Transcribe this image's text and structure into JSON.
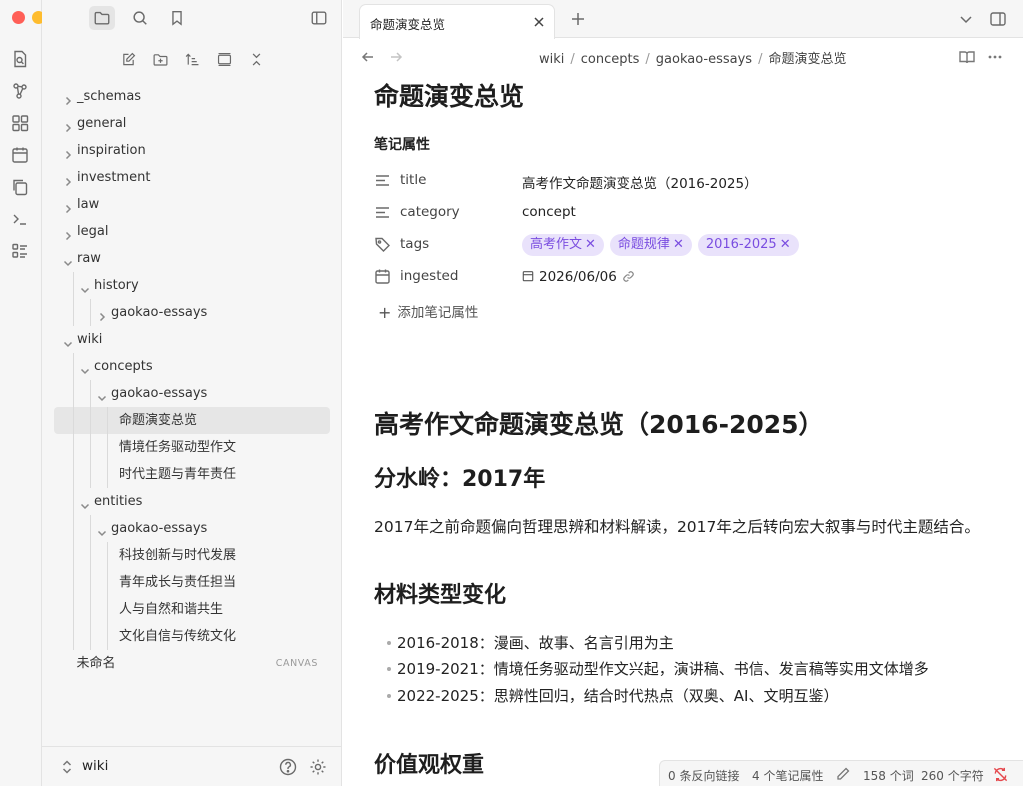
{
  "window": {
    "traffic_colors": [
      "#ff5f57",
      "#febc2e",
      "#28c840"
    ]
  },
  "ribbon": {
    "icons": [
      "file-search-icon",
      "graph-icon",
      "blocks-icon",
      "calendar-icon",
      "copy-icon",
      "terminal-icon",
      "list-icon"
    ]
  },
  "sidebar": {
    "top_icons": [
      "folder-icon",
      "search-icon",
      "bookmark-icon"
    ],
    "nav_icons": [
      "new-note-icon",
      "new-folder-icon",
      "sort-icon",
      "collapse-view-icon",
      "collapse-all-icon"
    ],
    "tree": [
      {
        "label": "_schemas",
        "depth": 0,
        "chevron": "right"
      },
      {
        "label": "general",
        "depth": 0,
        "chevron": "right"
      },
      {
        "label": "inspiration",
        "depth": 0,
        "chevron": "right"
      },
      {
        "label": "investment",
        "depth": 0,
        "chevron": "right"
      },
      {
        "label": "law",
        "depth": 0,
        "chevron": "right"
      },
      {
        "label": "legal",
        "depth": 0,
        "chevron": "right"
      },
      {
        "label": "raw",
        "depth": 0,
        "chevron": "down"
      },
      {
        "label": "history",
        "depth": 1,
        "chevron": "down"
      },
      {
        "label": "gaokao-essays",
        "depth": 2,
        "chevron": "right"
      },
      {
        "label": "wiki",
        "depth": 0,
        "chevron": "down"
      },
      {
        "label": "concepts",
        "depth": 1,
        "chevron": "down"
      },
      {
        "label": "gaokao-essays",
        "depth": 2,
        "chevron": "down"
      },
      {
        "label": "命题演变总览",
        "depth": 3,
        "chevron": "none",
        "active": true
      },
      {
        "label": "情境任务驱动型作文",
        "depth": 3,
        "chevron": "none"
      },
      {
        "label": "时代主题与青年责任",
        "depth": 3,
        "chevron": "none"
      },
      {
        "label": "entities",
        "depth": 1,
        "chevron": "down"
      },
      {
        "label": "gaokao-essays",
        "depth": 2,
        "chevron": "down"
      },
      {
        "label": "科技创新与时代发展",
        "depth": 3,
        "chevron": "none"
      },
      {
        "label": "青年成长与责任担当",
        "depth": 3,
        "chevron": "none"
      },
      {
        "label": "人与自然和谐共生",
        "depth": 3,
        "chevron": "none"
      },
      {
        "label": "文化自信与传统文化",
        "depth": 3,
        "chevron": "none"
      },
      {
        "label": "未命名",
        "depth": 0.5,
        "chevron": "none",
        "tag": "CANVAS"
      }
    ],
    "vault_name": "wiki"
  },
  "tab": {
    "title": "命题演变总览"
  },
  "breadcrumb": [
    "wiki",
    "concepts",
    "gaokao-essays",
    "命题演变总览"
  ],
  "note": {
    "title": "命题演变总览",
    "properties_heading": "笔记属性",
    "properties": {
      "title": {
        "key": "title",
        "value": "高考作文命题演变总览（2016-2025）"
      },
      "category": {
        "key": "category",
        "value": "concept"
      },
      "tags": {
        "key": "tags",
        "values": [
          "高考作文",
          "命题规律",
          "2016-2025"
        ]
      },
      "ingested": {
        "key": "ingested",
        "value": "2026/06/06"
      }
    },
    "add_property": "添加笔记属性",
    "h1": "高考作文命题演变总览（2016-2025）",
    "h2_watershed": "分水岭：2017年",
    "para_watershed": "2017年之前命题偏向哲理思辨和材料解读，2017年之后转向宏大叙事与时代主题结合。",
    "h2_material": "材料类型变化",
    "bullets": [
      "2016-2018：漫画、故事、名言引用为主",
      "2019-2021：情境任务驱动型作文兴起，演讲稿、书信、发言稿等实用文体增多",
      "2022-2025：思辨性回归，结合时代热点（双奥、AI、文明互鉴）"
    ],
    "h2_values": "价值观权重"
  },
  "status": {
    "backlinks": "0 条反向链接",
    "properties": "4 个笔记属性",
    "words": "158 个词",
    "chars": "260 个字符"
  },
  "colors": {
    "tag_bg": "#e9e2fb",
    "tag_fg": "#7a4de0",
    "sync_error": "#e5484d"
  }
}
